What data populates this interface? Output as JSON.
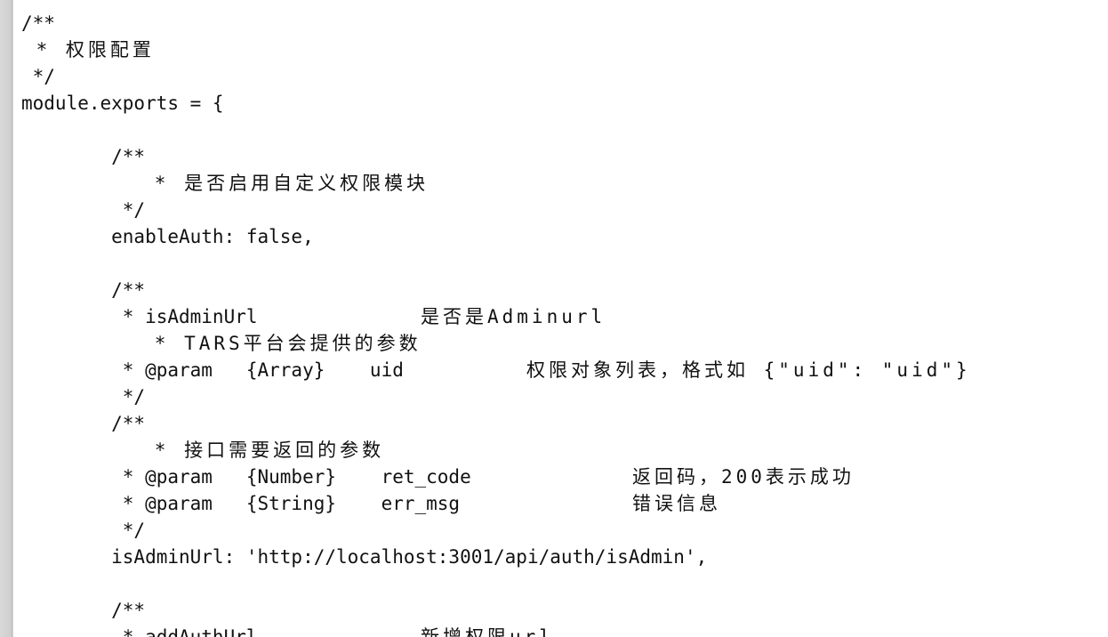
{
  "editor": {
    "lines": [
      {
        "text": "/**"
      },
      {
        "text": " * 权限配置"
      },
      {
        "text": " */"
      },
      {
        "text": "module.exports = {"
      },
      {
        "text": ""
      },
      {
        "text": "        /**"
      },
      {
        "text": "         * 是否启用自定义权限模块"
      },
      {
        "text": "         */"
      },
      {
        "text": "        enableAuth: false,"
      },
      {
        "text": ""
      },
      {
        "text": "        /**"
      },
      {
        "text": "         * isAdminUrl",
        "col2": "是否是Adminurl"
      },
      {
        "text": "         * TARS平台会提供的参数"
      },
      {
        "text": "         * @param   {Array}    uid",
        "col2": "权限对象列表，格式如 {\"uid\": \"uid\"}"
      },
      {
        "text": "         */"
      },
      {
        "text": "        /**"
      },
      {
        "text": "         * 接口需要返回的参数"
      },
      {
        "text": "         * @param   {Number}    ret_code",
        "col2": "返回码，200表示成功"
      },
      {
        "text": "         * @param   {String}    err_msg",
        "col2": "错误信息"
      },
      {
        "text": "         */"
      },
      {
        "text": "        isAdminUrl: 'http://localhost:3001/api/auth/isAdmin',"
      },
      {
        "text": ""
      },
      {
        "text": "        /**"
      },
      {
        "text": "         * addAuthUrl",
        "col2": "新增权限url"
      }
    ]
  }
}
